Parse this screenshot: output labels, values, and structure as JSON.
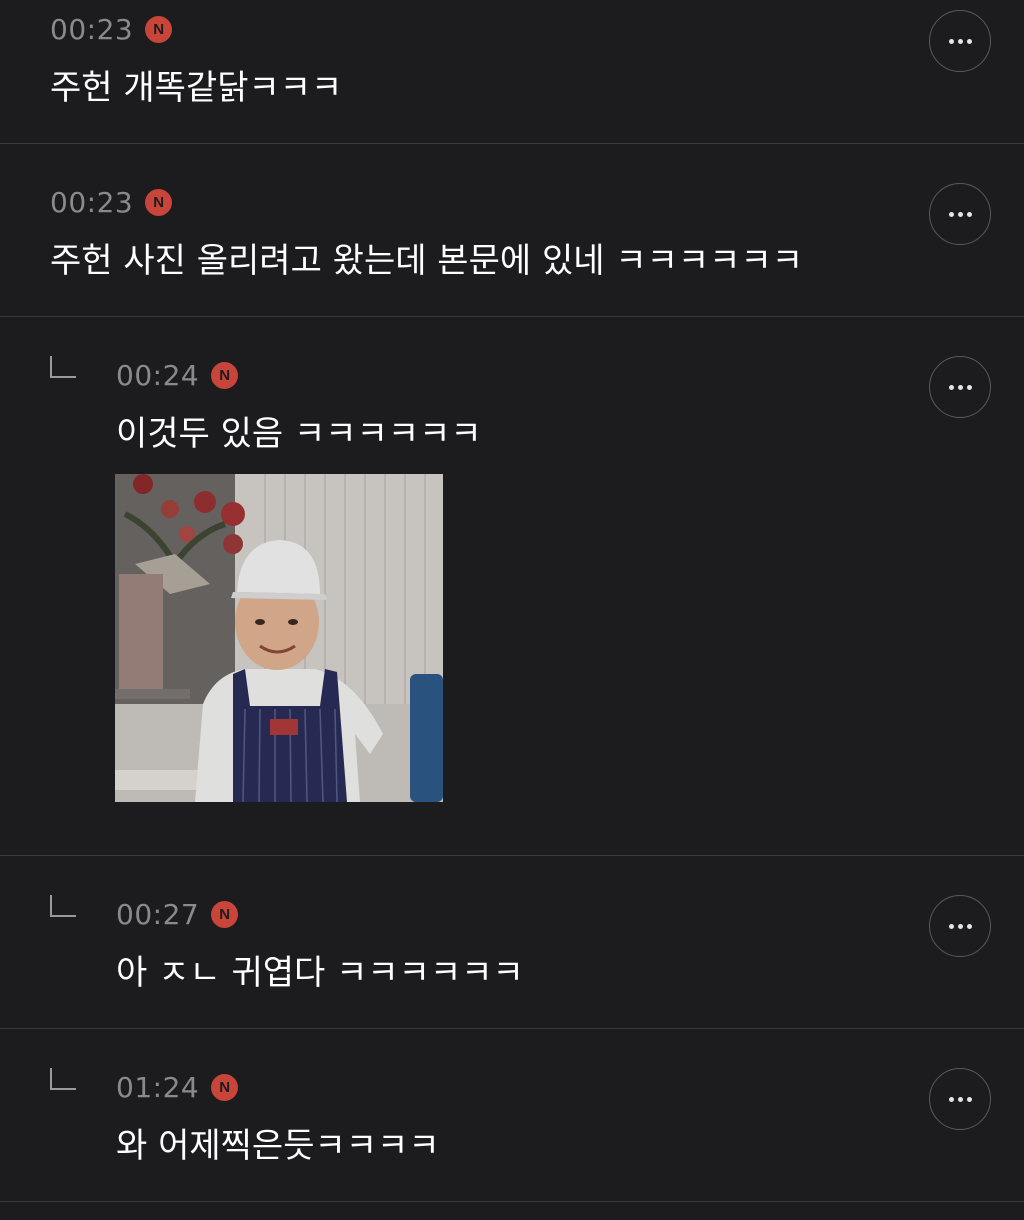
{
  "comments": [
    {
      "time": "00:23",
      "badge": "N",
      "text": "주헌 개똑같닭ㅋㅋㅋ",
      "is_reply": false
    },
    {
      "time": "00:23",
      "badge": "N",
      "text": "주헌 사진 올리려고 왔는데 본문에 있네 ㅋㅋㅋㅋㅋㅋ",
      "is_reply": false
    },
    {
      "time": "00:24",
      "badge": "N",
      "text": "이것두 있음 ㅋㅋㅋㅋㅋㅋ",
      "is_reply": true,
      "has_photo": true
    },
    {
      "time": "00:27",
      "badge": "N",
      "text": "아 ㅈㄴ 귀엽다 ㅋㅋㅋㅋㅋㅋ",
      "is_reply": true
    },
    {
      "time": "01:24",
      "badge": "N",
      "text": "와 어제찍은듯ㅋㅋㅋㅋ",
      "is_reply": true
    }
  ],
  "icons": {
    "new_badge": "new-badge-icon",
    "more": "more-options-icon",
    "reply": "reply-arrow-icon"
  },
  "colors": {
    "background": "#1c1c1e",
    "divider": "#3a3a3c",
    "timestamp": "#8a8a8e",
    "badge": "#c9453a",
    "text": "#ffffff"
  }
}
